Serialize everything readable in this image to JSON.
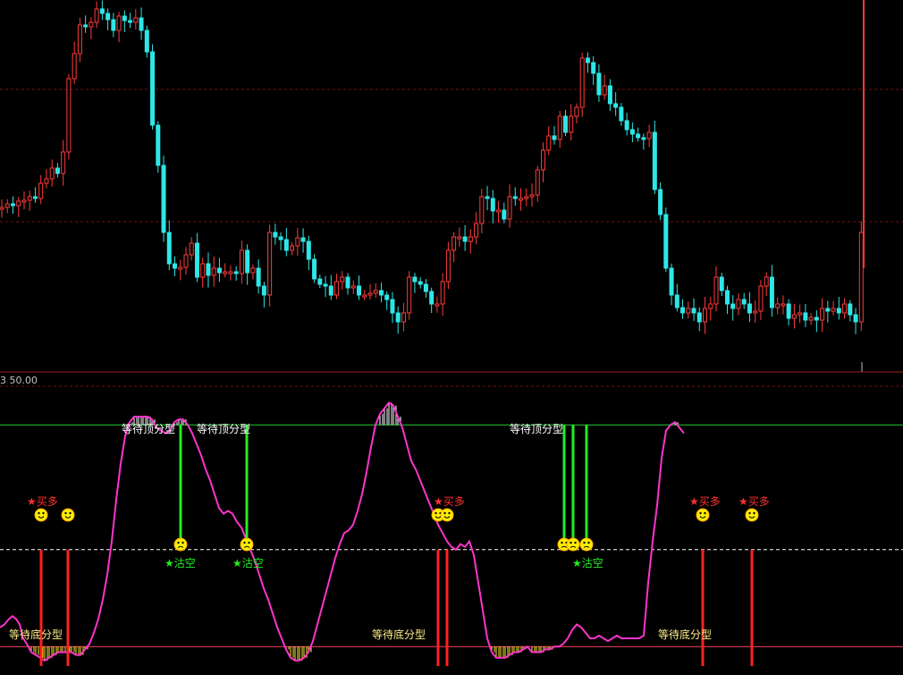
{
  "chart_data": [
    {
      "type": "candlestick",
      "title": "",
      "xlabel": "",
      "ylabel": "",
      "grid": true,
      "up_color": "#ff3b3b",
      "down_color": "#2ee6e6",
      "closes": [
        168,
        172,
        170,
        175,
        176,
        180,
        178,
        195,
        200,
        212,
        206,
        230,
        312,
        340,
        372,
        370,
        375,
        390,
        385,
        378,
        366,
        382,
        377,
        375,
        380,
        366,
        342,
        260,
        215,
        140,
        105,
        100,
        101,
        115,
        128,
        90,
        105,
        92,
        100,
        95,
        96,
        96,
        94,
        120,
        95,
        100,
        80,
        70,
        140,
        135,
        132,
        120,
        125,
        134,
        130,
        110,
        88,
        82,
        80,
        70,
        85,
        90,
        78,
        80,
        70,
        70,
        72,
        75,
        70,
        65,
        50,
        40,
        50,
        90,
        85,
        82,
        74,
        60,
        60,
        85,
        120,
        135,
        135,
        130,
        135,
        150,
        180,
        178,
        164,
        165,
        155,
        180,
        178,
        178,
        180,
        182,
        210,
        232,
        248,
        244,
        270,
        252,
        270,
        280,
        335,
        330,
        318,
        294,
        304,
        284,
        280,
        265,
        255,
        250,
        246,
        245,
        252,
        188,
        160,
        100,
        70,
        56,
        50,
        55,
        50,
        40,
        55,
        60,
        90,
        75,
        60,
        55,
        65,
        60,
        50,
        52,
        80,
        90,
        56,
        60,
        60,
        44,
        48,
        50,
        42,
        45,
        42,
        55,
        52,
        55,
        50,
        60,
        48,
        40,
        140,
        0,
        0,
        0,
        0,
        0,
        0
      ],
      "ylim": [
        0,
        410
      ],
      "price_reference_levels": [
        2,
        3
      ]
    },
    {
      "type": "line",
      "panel_label": "3 50.00",
      "title": "",
      "series_color": "#ff33cc",
      "ylim": [
        0,
        100
      ],
      "reference_lines": [
        {
          "value": 87,
          "color": "#22cc33",
          "style": "solid"
        },
        {
          "value": 42,
          "color": "#ffffff",
          "style": "dashed"
        },
        {
          "value": 7,
          "color": "#ff4466",
          "style": "solid"
        }
      ],
      "x_index": [
        0,
        5,
        10,
        14,
        18,
        22,
        26,
        30,
        35,
        40,
        45,
        50,
        55,
        60,
        65,
        70,
        75,
        80,
        85,
        90,
        95,
        100,
        105,
        110,
        115,
        120,
        125,
        130,
        135,
        140,
        145,
        150,
        155,
        160,
        165,
        170,
        175,
        180,
        185,
        190,
        195,
        200,
        205,
        210,
        215,
        220,
        225,
        230,
        235,
        240,
        245,
        250,
        255,
        260,
        265,
        270,
        275,
        280,
        285,
        290,
        295,
        300,
        305,
        310,
        315,
        320,
        325,
        330,
        335,
        340,
        345,
        350,
        355,
        360,
        365,
        370,
        375,
        380,
        385,
        390,
        395,
        400,
        405,
        410,
        415,
        420,
        425,
        430,
        435,
        440,
        445,
        450,
        455,
        460,
        465,
        470,
        475,
        480,
        485,
        490,
        495,
        500,
        505,
        510,
        515,
        520,
        525,
        530,
        535,
        540,
        545,
        550,
        555,
        560,
        565,
        570,
        575,
        580,
        585,
        590,
        595,
        600,
        605,
        610,
        615,
        620,
        625,
        630,
        635,
        640,
        645,
        650,
        655,
        660,
        665,
        670,
        675,
        680,
        685,
        690,
        695,
        700,
        705,
        710,
        715,
        720,
        725,
        730,
        735,
        740,
        745,
        750,
        755,
        760,
        765,
        770,
        775,
        780,
        785,
        790,
        795,
        800,
        805,
        810,
        815,
        820,
        825,
        830,
        835,
        840,
        845,
        850,
        855,
        860,
        865,
        870,
        875,
        880,
        885,
        890,
        895,
        900,
        905,
        910,
        915,
        920,
        925,
        930,
        935,
        940,
        945,
        950,
        955,
        960,
        965,
        970,
        975,
        980,
        985,
        990,
        995,
        1000,
        1005,
        1010
      ],
      "values": [
        14,
        15,
        17,
        18,
        17,
        15,
        10,
        8,
        5,
        4,
        3,
        2,
        3,
        4,
        5,
        5,
        5,
        5,
        4,
        4,
        6,
        8,
        12,
        17,
        24,
        33,
        45,
        60,
        73,
        83,
        88,
        90,
        90,
        90,
        90,
        89,
        86,
        85,
        84,
        85,
        88,
        89,
        89,
        87,
        84,
        80,
        76,
        71,
        67,
        62,
        57,
        55,
        56,
        55,
        52,
        50,
        46,
        42,
        38,
        33,
        28,
        24,
        19,
        14,
        10,
        6,
        3,
        2,
        2,
        3,
        5,
        9,
        15,
        21,
        27,
        33,
        39,
        44,
        48,
        49,
        51,
        56,
        62,
        70,
        79,
        87,
        91,
        93,
        95,
        94,
        90,
        86,
        80,
        74,
        71,
        67,
        63,
        59,
        55,
        51,
        48,
        45,
        43,
        42,
        44,
        43,
        45,
        40,
        30,
        20,
        10,
        5,
        3,
        3,
        3,
        4,
        5,
        5,
        6,
        7,
        5,
        5,
        5,
        6,
        6,
        7,
        7,
        8,
        10,
        13,
        15,
        14,
        12,
        10,
        10,
        11,
        10,
        9,
        10,
        11,
        10,
        10,
        10,
        10,
        10,
        11,
        30,
        45,
        58,
        75,
        85,
        87,
        88,
        86,
        84
      ],
      "annotations": [
        {
          "text": "等待顶分型",
          "type": "top-wait"
        },
        {
          "text": "等待顶分型",
          "type": "top-wait"
        },
        {
          "text": "等待顶分型",
          "type": "top-wait"
        },
        {
          "text": "等待底分型",
          "type": "bottom-wait"
        },
        {
          "text": "等待底分型",
          "type": "bottom-wait"
        },
        {
          "text": "等待底分型",
          "type": "bottom-wait"
        },
        {
          "text": "★买多",
          "type": "buy"
        },
        {
          "text": "★买多",
          "type": "buy"
        },
        {
          "text": "★买多",
          "type": "buy"
        },
        {
          "text": "★买多",
          "type": "buy"
        },
        {
          "text": "★沽空",
          "type": "sell"
        },
        {
          "text": "★沽空",
          "type": "sell"
        },
        {
          "text": "★沽空",
          "type": "sell"
        }
      ],
      "buy_signal_color": "#ff2020",
      "sell_signal_color": "#22ee22"
    }
  ]
}
